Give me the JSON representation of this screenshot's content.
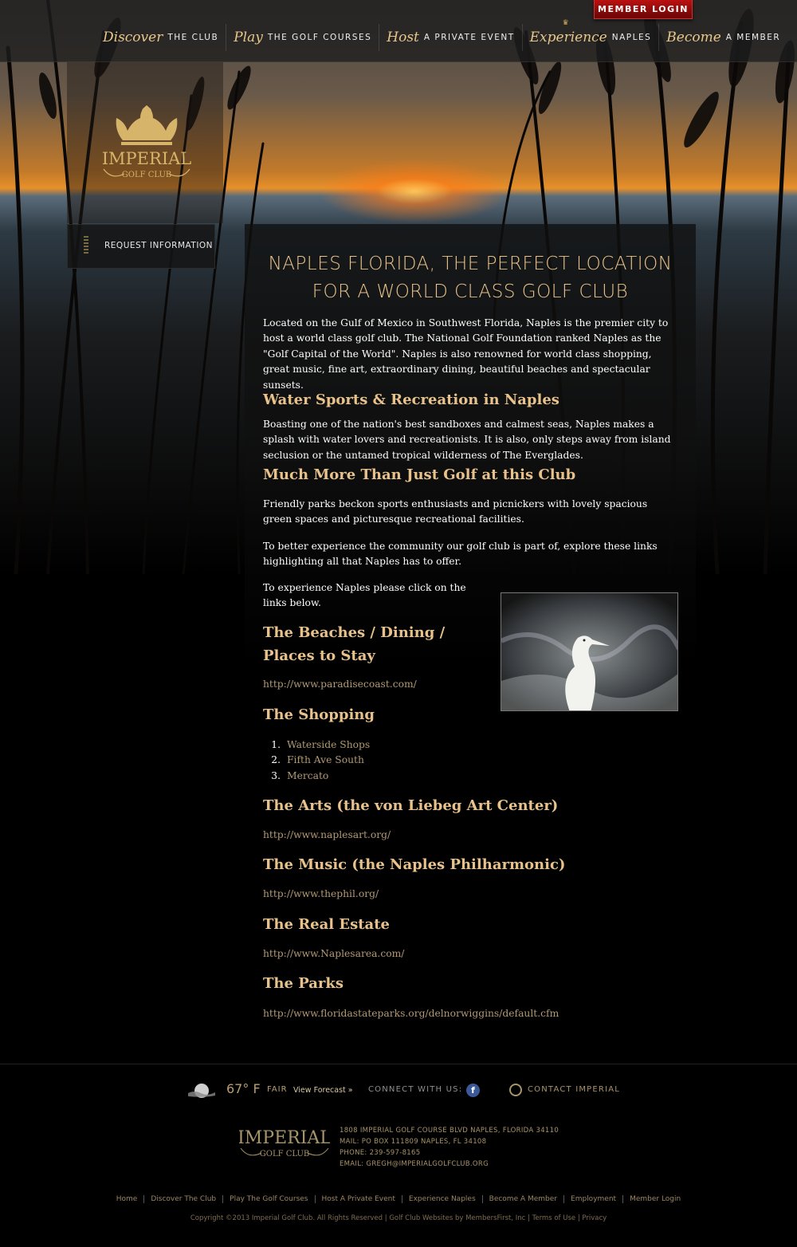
{
  "header": {
    "member_login": "MEMBER LOGIN",
    "nav": [
      {
        "script": "Discover",
        "label": "THE CLUB"
      },
      {
        "script": "Play",
        "label": "THE GOLF COURSES"
      },
      {
        "script": "Host",
        "label": "A PRIVATE EVENT"
      },
      {
        "script": "Experience",
        "label": "NAPLES"
      },
      {
        "script": "Become",
        "label": "A MEMBER"
      }
    ]
  },
  "logo": {
    "line1": "IMPERIAL",
    "line2": "GOLF CLUB"
  },
  "sidebar": {
    "request_info": "REQUEST INFORMATION"
  },
  "content": {
    "title_line1": "NAPLES FLORIDA, THE PERFECT LOCATION",
    "title_line2": "FOR A WORLD CLASS GOLF CLUB",
    "intro": "Located on the Gulf of Mexico in Southwest Florida, Naples is the premier city to host a world class golf club. The National Golf Foundation ranked Naples as the \"Golf Capital of the World\". Naples is also renowned for world class shopping, great music, fine art, extraordinary dining, beautiful beaches and spectacular sunsets.",
    "h_water": "Water Sports & Recreation in Naples",
    "p_water": "Boasting one of the nation's best sandboxes and calmest seas, Naples makes a splash with water lovers and recreationists. It is also, only steps away from island seclusion or the untamed tropical wilderness of The Everglades.",
    "h_more": "Much More Than Just Golf at this Club",
    "p_parks": "Friendly parks beckon sports enthusiasts and picnickers with lovely spacious green spaces and picturesque recreational facilities.",
    "p_explore": "To better experience the community our golf club is part of, explore these links highlighting all that Naples has to offer.",
    "p_click": "To experience Naples please click on the links below.",
    "h_beaches": "The Beaches / Dining / Places to Stay",
    "link_beaches": "http://www.paradisecoast.com/",
    "h_shopping": "The Shopping",
    "shops": [
      "Waterside Shops",
      "Fifth Ave South",
      "Mercato"
    ],
    "h_arts": "The Arts (the von Liebeg Art Center)",
    "link_arts": "http://www.naplesart.org/",
    "h_music": "The Music (the Naples Philharmonic)",
    "link_music": "http://www.thephil.org/",
    "h_realestate": "The Real Estate",
    "link_realestate": "http://www.Naplesarea.com/",
    "h_parks": "The Parks",
    "link_parks": "http://www.floridastateparks.org/delnorwiggins/default.cfm"
  },
  "footer": {
    "temp": "67° F",
    "condition": "FAIR",
    "forecast": "View Forecast »",
    "connect": "CONNECT WITH US:",
    "facebook": "f",
    "contact": "CONTACT IMPERIAL",
    "address_lines": [
      "1808 IMPERIAL GOLF COURSE BLVD NAPLES, FLORIDA 34110",
      "MAIL: PO BOX 111809 NAPLES, FL 34108",
      "PHONE: 239-597-8165",
      "EMAIL: GREGH@IMPERIALGOLFCLUB.ORG"
    ],
    "nav": [
      "Home",
      "Discover The Club",
      "Play The Golf Courses",
      "Host A Private Event",
      "Experience Naples",
      "Become A Member",
      "Employment",
      "Member Login"
    ],
    "copyright": "Copyright ©2013 Imperial Golf Club. All Rights Reserved | Golf Club Websites by MembersFirst, Inc | Terms of Use | Privacy"
  }
}
